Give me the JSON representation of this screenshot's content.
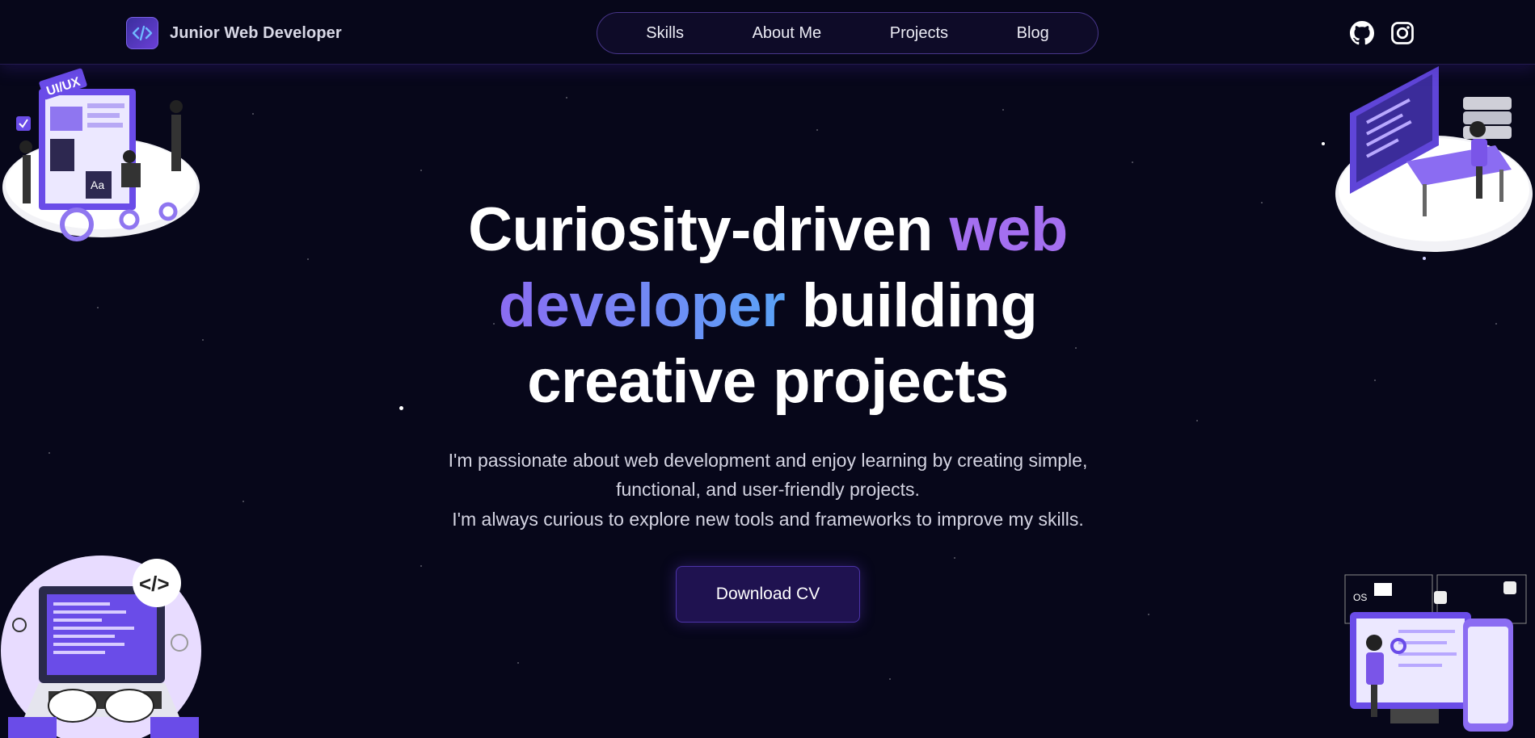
{
  "brand": {
    "name": "Junior Web Developer",
    "logo_icon": "code-brackets-icon"
  },
  "nav": {
    "items": [
      "Skills",
      "About Me",
      "Projects",
      "Blog"
    ]
  },
  "social": [
    {
      "icon": "github-icon"
    },
    {
      "icon": "instagram-icon"
    }
  ],
  "hero": {
    "title": {
      "part1": "Curiosity-driven ",
      "highlight1": "web",
      "highlight2": "developer",
      "part2": " building",
      "line3": "creative projects"
    },
    "paragraph1": "I'm passionate about web development and enjoy learning by creating simple, functional, and user-friendly projects.",
    "paragraph2": "I'm always curious to explore new tools and frameworks to improve my skills.",
    "cta_label": "Download CV"
  },
  "illustrations": {
    "top_left_badge": "UI/UX",
    "top_left_aa": "Aa",
    "bottom_right_os": "OS"
  },
  "colors": {
    "background": "#07071a",
    "accent_purple": "#a46ff0",
    "accent_blue": "#5aa3f7",
    "button": "#1f1250"
  }
}
